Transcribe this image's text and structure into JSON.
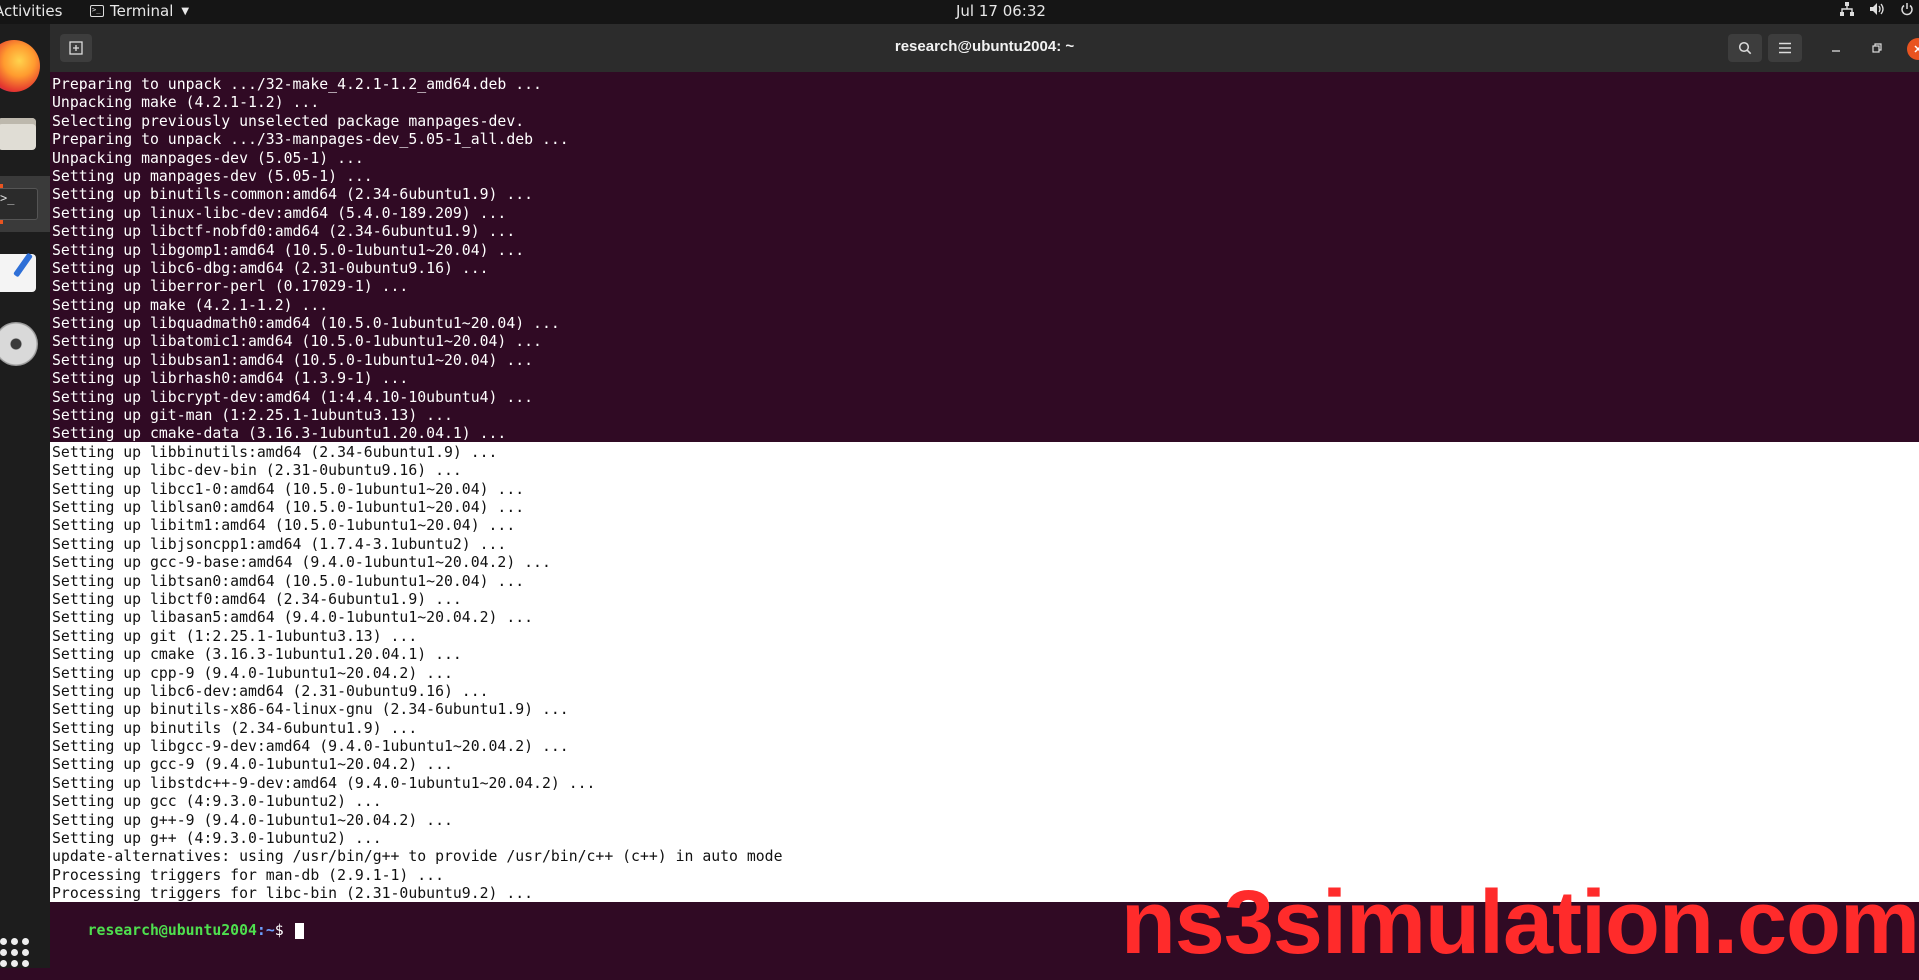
{
  "topbar": {
    "activities": "Activities",
    "app_name": "Terminal",
    "clock": "Jul 17  06:32",
    "tray": [
      "network-icon",
      "volume-icon",
      "power-icon"
    ]
  },
  "dock": {
    "items": [
      "firefox-icon",
      "files-icon",
      "terminal-icon",
      "text-editor-icon",
      "disc-icon",
      "show-applications-icon"
    ],
    "accent": "#e95420"
  },
  "window": {
    "title": "research@ubuntu2004: ~"
  },
  "terminal": {
    "background": "#300a24",
    "lines_unselected": [
      "Preparing to unpack .../32-make_4.2.1-1.2_amd64.deb ...",
      "Unpacking make (4.2.1-1.2) ...",
      "Selecting previously unselected package manpages-dev.",
      "Preparing to unpack .../33-manpages-dev_5.05-1_all.deb ...",
      "Unpacking manpages-dev (5.05-1) ...",
      "Setting up manpages-dev (5.05-1) ...",
      "Setting up binutils-common:amd64 (2.34-6ubuntu1.9) ...",
      "Setting up linux-libc-dev:amd64 (5.4.0-189.209) ...",
      "Setting up libctf-nobfd0:amd64 (2.34-6ubuntu1.9) ...",
      "Setting up libgomp1:amd64 (10.5.0-1ubuntu1~20.04) ...",
      "Setting up libc6-dbg:amd64 (2.31-0ubuntu9.16) ...",
      "Setting up liberror-perl (0.17029-1) ...",
      "Setting up make (4.2.1-1.2) ...",
      "Setting up libquadmath0:amd64 (10.5.0-1ubuntu1~20.04) ...",
      "Setting up libatomic1:amd64 (10.5.0-1ubuntu1~20.04) ...",
      "Setting up libubsan1:amd64 (10.5.0-1ubuntu1~20.04) ...",
      "Setting up librhash0:amd64 (1.3.9-1) ...",
      "Setting up libcrypt-dev:amd64 (1:4.4.10-10ubuntu4) ...",
      "Setting up git-man (1:2.25.1-1ubuntu3.13) ...",
      "Setting up cmake-data (3.16.3-1ubuntu1.20.04.1) ..."
    ],
    "lines_selected": [
      "Setting up libbinutils:amd64 (2.34-6ubuntu1.9) ...",
      "Setting up libc-dev-bin (2.31-0ubuntu9.16) ...",
      "Setting up libcc1-0:amd64 (10.5.0-1ubuntu1~20.04) ...",
      "Setting up liblsan0:amd64 (10.5.0-1ubuntu1~20.04) ...",
      "Setting up libitm1:amd64 (10.5.0-1ubuntu1~20.04) ...",
      "Setting up libjsoncpp1:amd64 (1.7.4-3.1ubuntu2) ...",
      "Setting up gcc-9-base:amd64 (9.4.0-1ubuntu1~20.04.2) ...",
      "Setting up libtsan0:amd64 (10.5.0-1ubuntu1~20.04) ...",
      "Setting up libctf0:amd64 (2.34-6ubuntu1.9) ...",
      "Setting up libasan5:amd64 (9.4.0-1ubuntu1~20.04.2) ...",
      "Setting up git (1:2.25.1-1ubuntu3.13) ...",
      "Setting up cmake (3.16.3-1ubuntu1.20.04.1) ...",
      "Setting up cpp-9 (9.4.0-1ubuntu1~20.04.2) ...",
      "Setting up libc6-dev:amd64 (2.31-0ubuntu9.16) ...",
      "Setting up binutils-x86-64-linux-gnu (2.34-6ubuntu1.9) ...",
      "Setting up binutils (2.34-6ubuntu1.9) ...",
      "Setting up libgcc-9-dev:amd64 (9.4.0-1ubuntu1~20.04.2) ...",
      "Setting up gcc-9 (9.4.0-1ubuntu1~20.04.2) ...",
      "Setting up libstdc++-9-dev:amd64 (9.4.0-1ubuntu1~20.04.2) ...",
      "Setting up gcc (4:9.3.0-1ubuntu2) ...",
      "Setting up g++-9 (9.4.0-1ubuntu1~20.04.2) ...",
      "Setting up g++ (4:9.3.0-1ubuntu2) ...",
      "update-alternatives: using /usr/bin/g++ to provide /usr/bin/c++ (c++) in auto mode",
      "Processing triggers for man-db (2.9.1-1) ...",
      "Processing triggers for libc-bin (2.31-0ubuntu9.2) ..."
    ],
    "prompt": {
      "user_host": "research@ubuntu2004",
      "path": ":~",
      "sign": "$ "
    }
  },
  "watermark": {
    "text": "ns3simulation.com",
    "color": "#ff2b2b"
  }
}
